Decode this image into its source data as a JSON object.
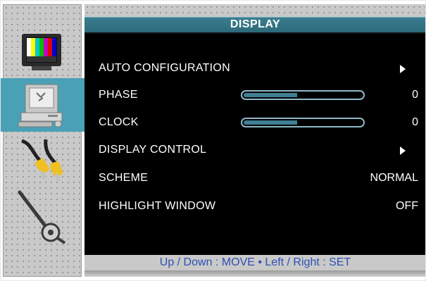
{
  "menu": {
    "title": "DISPLAY",
    "items": [
      {
        "label": "AUTO CONFIGURATION",
        "control": "arrow"
      },
      {
        "label": "PHASE",
        "control": "slider",
        "value": "0",
        "level": 0.45
      },
      {
        "label": "CLOCK",
        "control": "slider",
        "value": "0",
        "level": 0.45
      },
      {
        "label": "DISPLAY CONTROL",
        "control": "arrow"
      },
      {
        "label": "SCHEME",
        "control": "value",
        "value": "NORMAL"
      },
      {
        "label": "HIGHLIGHT WINDOW",
        "control": "value",
        "value": "OFF"
      }
    ]
  },
  "footer": {
    "help": "Up / Down : MOVE  •  Left / Right : SET"
  },
  "sidebar": {
    "icons": [
      "color-bars-monitor-icon",
      "computer-icon",
      "av-cables-icon",
      "wrench-icon"
    ],
    "selected_index": 1
  },
  "colors": {
    "header_bg": "#2d6a7b",
    "selected_bg": "#4aa1b5",
    "panel_bg": "#000000",
    "footer_text": "#2f4fb3",
    "slider_fill": "#3f7f93"
  }
}
